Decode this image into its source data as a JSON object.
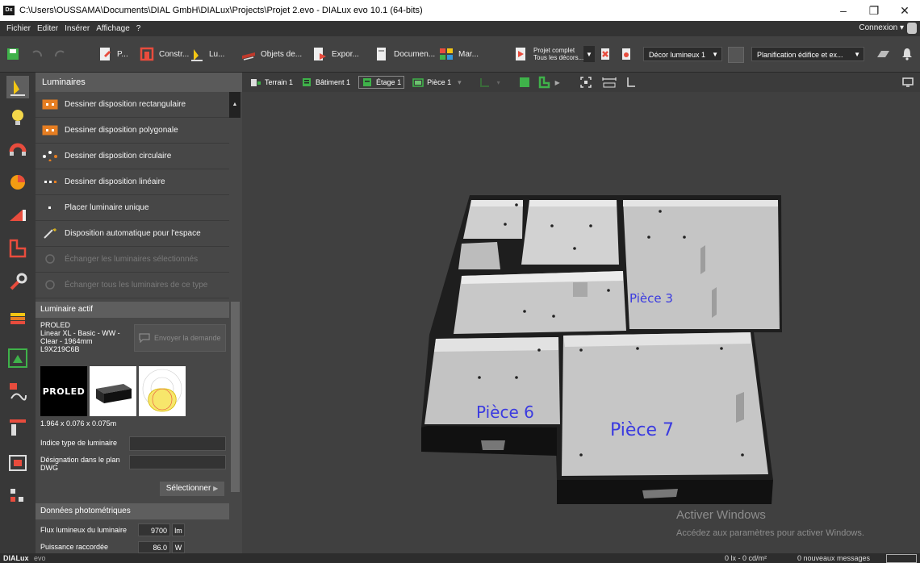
{
  "window": {
    "title": "C:\\Users\\OUSSAMA\\Documents\\DIAL GmbH\\DIALux\\Projects\\Projet 2.evo - DIALux evo 10.1  (64-bits)",
    "app_icon": "Dx",
    "minimize": "–",
    "maximize": "❐",
    "close": "✕"
  },
  "menu": {
    "items": [
      "Fichier",
      "Editer",
      "Insérer",
      "Affichage",
      "?"
    ],
    "connexion": "Connexion ▾"
  },
  "toolbar": {
    "tabs": [
      "P...",
      "Constr...",
      "Lu...",
      "Objets de...",
      "Expor...",
      "Documen...",
      "Mar..."
    ],
    "projet_complet_line1": "Projet complet",
    "projet_complet_line2": "Tous les décors...",
    "decor_dropdown": "Décor lumineux 1",
    "planification_dropdown": "Planification édifice et ex..."
  },
  "panel": {
    "header": "Luminaires",
    "actions": [
      {
        "label": "Dessiner disposition rectangulaire",
        "enabled": true
      },
      {
        "label": "Dessiner disposition polygonale",
        "enabled": true
      },
      {
        "label": "Dessiner disposition circulaire",
        "enabled": true
      },
      {
        "label": "Dessiner disposition linéaire",
        "enabled": true
      },
      {
        "label": "Placer luminaire unique",
        "enabled": true
      },
      {
        "label": "Disposition automatique pour l'espace",
        "enabled": true
      },
      {
        "label": "Échanger les luminaires sélectionnés",
        "enabled": false
      },
      {
        "label": "Échanger tous les luminaires de ce type",
        "enabled": false
      }
    ],
    "active_section": "Luminaire actif",
    "luminaire_name": "PROLED",
    "luminaire_desc_1": "Linear XL - Basic - WW -",
    "luminaire_desc_2": "Clear - 1964mm",
    "luminaire_code": "L9X219C6B",
    "send_request": "Envoyer la demande",
    "brand_logo": "PROLED",
    "dimensions": "1.964 x 0.076 x 0.075m",
    "indice_label": "Indice type de luminaire",
    "designation_label_1": "Désignation dans le plan",
    "designation_label_2": "DWG",
    "select_button": "Sélectionner",
    "photometric_section": "Données photométriques",
    "flux_label": "Flux lumineux du luminaire",
    "flux_value": "9700",
    "flux_unit": "lm",
    "power_label": "Puissance raccordée",
    "power_value": "86.0",
    "power_unit": "W"
  },
  "viewport": {
    "breadcrumbs": [
      "Terrain 1",
      "Bâtiment 1",
      "Étage 1",
      "Pièce 1"
    ],
    "rooms": [
      "Pièce 3",
      "Pièce 6",
      "Pièce 7"
    ]
  },
  "watermark": {
    "line1": "Activer Windows",
    "line2": "Accédez aux paramètres pour activer Windows."
  },
  "status": {
    "brand_a": "DIALux",
    "brand_b": "evo",
    "illuminance": "0 lx - 0 cd/m²",
    "messages": "0 nouveaux messages"
  }
}
